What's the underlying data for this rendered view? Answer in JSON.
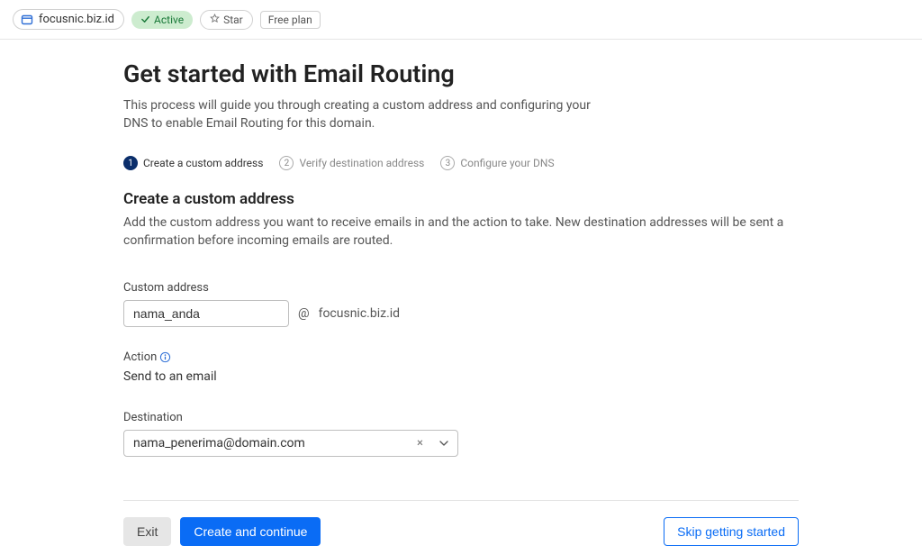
{
  "header": {
    "domain": "focusnic.biz.id",
    "status": "Active",
    "star_label": "Star",
    "plan_label": "Free plan"
  },
  "page": {
    "title": "Get started with Email Routing",
    "subtitle": "This process will guide you through creating a custom address and configuring your DNS to enable Email Routing for this domain."
  },
  "steps": [
    {
      "num": "1",
      "label": "Create a custom address",
      "active": true
    },
    {
      "num": "2",
      "label": "Verify destination address",
      "active": false
    },
    {
      "num": "3",
      "label": "Configure your DNS",
      "active": false
    }
  ],
  "section": {
    "title": "Create a custom address",
    "subtitle": "Add the custom address you want to receive emails in and the action to take. New destination addresses will be sent a confirmation before incoming emails are routed."
  },
  "form": {
    "custom_address": {
      "label": "Custom address",
      "value": "nama_anda",
      "at": "@",
      "domain": "focusnic.biz.id"
    },
    "action": {
      "label": "Action",
      "value": "Send to an email"
    },
    "destination": {
      "label": "Destination",
      "value": "nama_penerima@domain.com"
    }
  },
  "footer": {
    "exit": "Exit",
    "create": "Create and continue",
    "skip": "Skip getting started"
  }
}
